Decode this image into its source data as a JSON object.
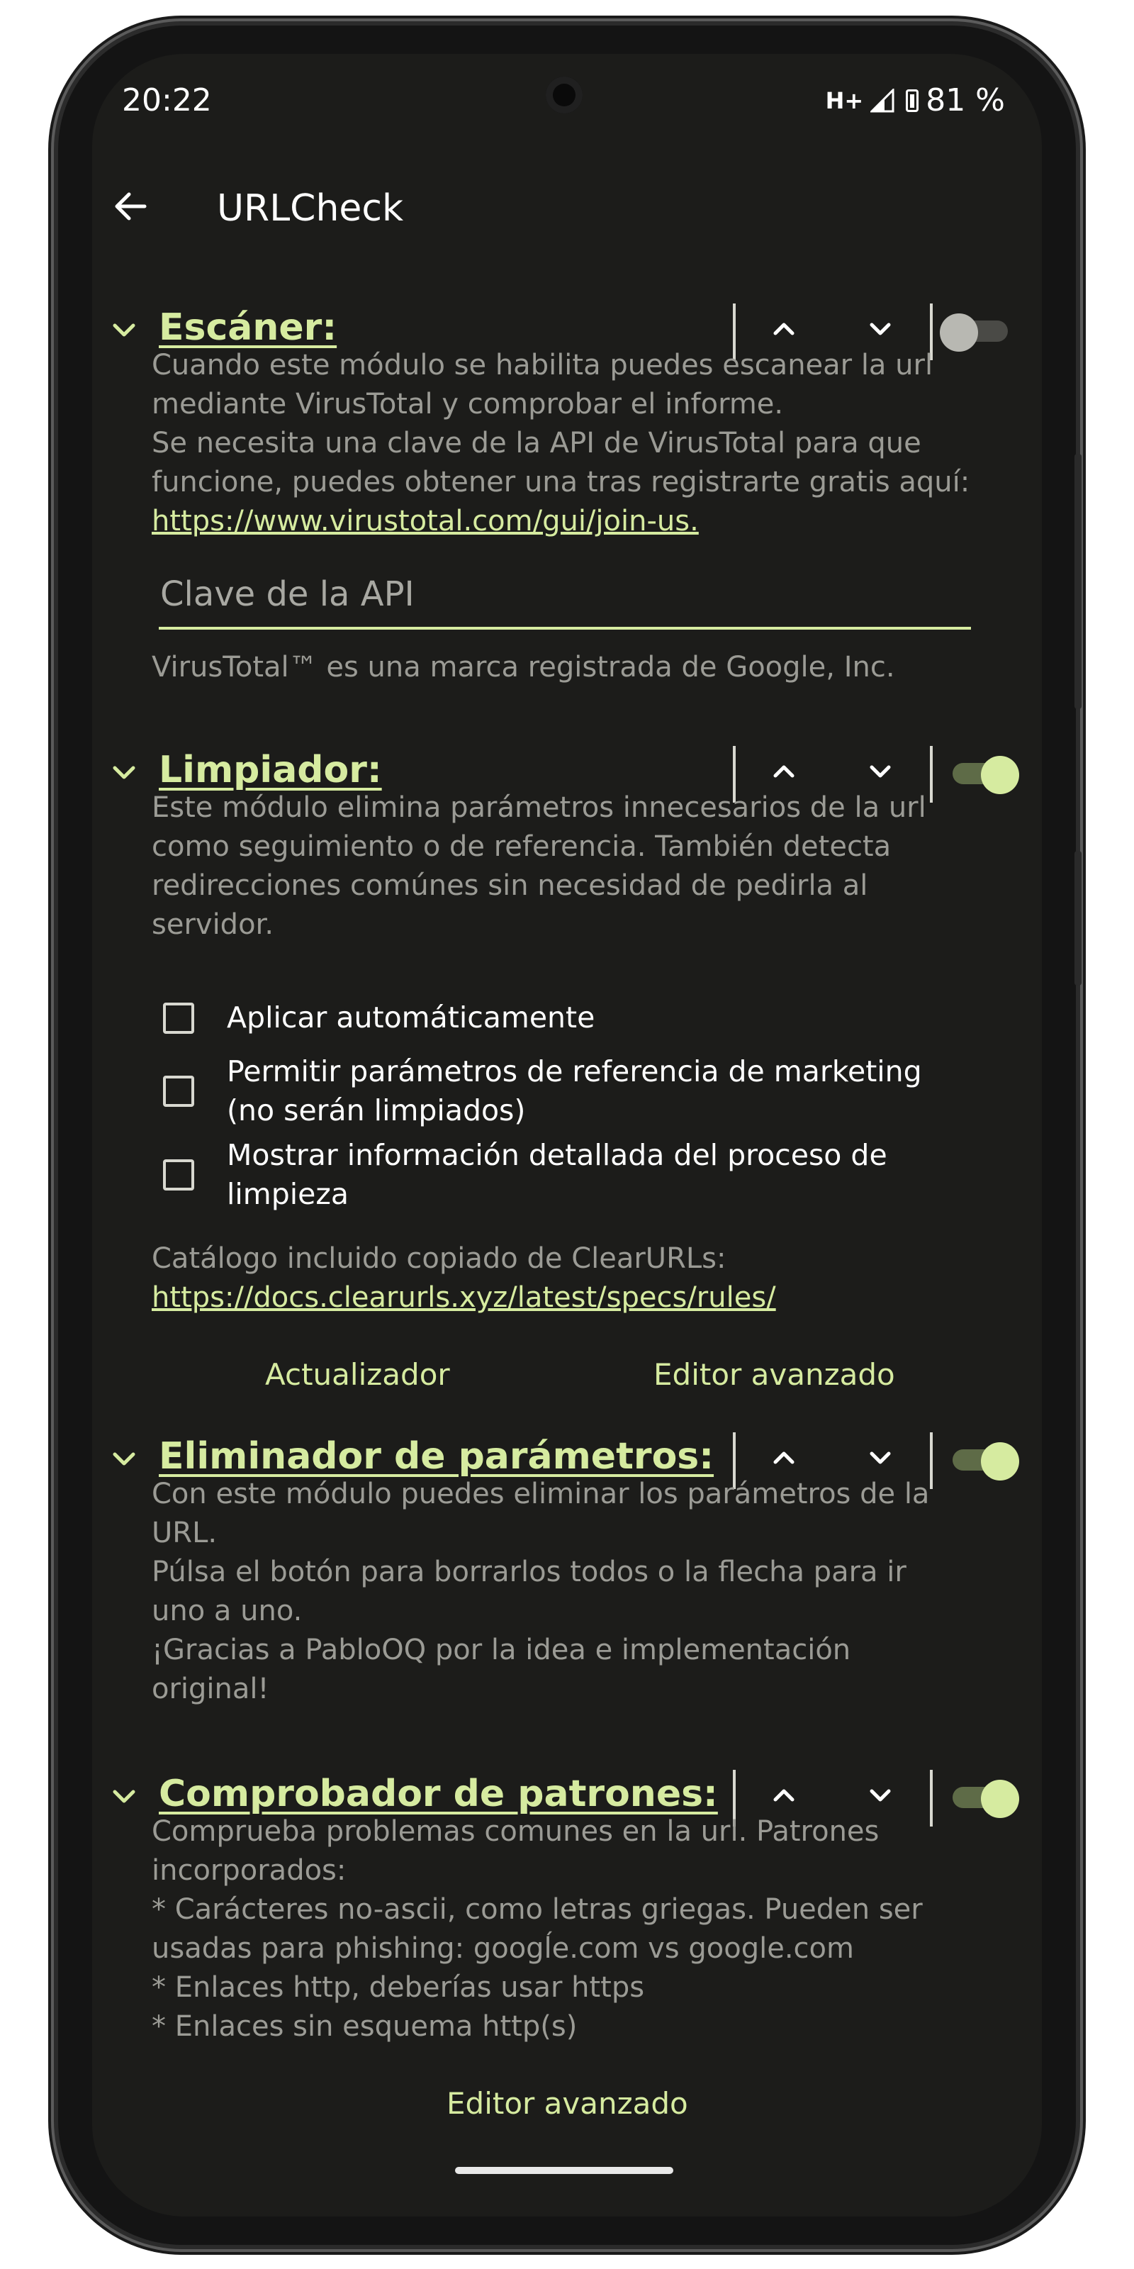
{
  "status_bar": {
    "time": "20:22",
    "network": "H+",
    "battery": "81 %"
  },
  "app_bar": {
    "title": "URLCheck",
    "back_icon": "arrow-left-icon"
  },
  "colors": {
    "accent": "#d6eba0",
    "background": "#1c1c1a",
    "body_text": "#9b9b95"
  },
  "modules": {
    "scanner": {
      "title": "Escáner:",
      "enabled": false,
      "description": [
        "Cuando este módulo se habilita puedes escanear la url",
        "mediante VirusTotal y comprobar el informe.",
        "Se necesita una clave de la API de VirusTotal para que",
        "funcione, puedes obtener una tras registrarte gratis aquí:"
      ],
      "link": "https://www.virustotal.com/gui/join-us.",
      "api_key_placeholder": "Clave de la API",
      "trademark": "VirusTotal™ es una marca registrada de Google, Inc."
    },
    "cleaner": {
      "title": "Limpiador:",
      "enabled": true,
      "description": [
        "Este módulo elimina parámetros innecesarios de la url",
        "como seguimiento o de referencia. También detecta",
        "redirecciones comúnes sin necesidad de pedirla al",
        "servidor."
      ],
      "options": [
        {
          "label": "Aplicar automáticamente",
          "checked": false
        },
        {
          "label": "Permitir parámetros de referencia de marketing (no serán limpiados)",
          "checked": false
        },
        {
          "label": "Mostrar información detallada del proceso de limpieza",
          "checked": false
        }
      ],
      "catalog_text": "Catálogo incluido copiado de ClearURLs:",
      "catalog_link": "https://docs.clearurls.xyz/latest/specs/rules/",
      "updater_button": "Actualizador",
      "advanced_editor_button": "Editor avanzado"
    },
    "param_remover": {
      "title": "Eliminador de parámetros:",
      "enabled": true,
      "description": [
        "Con este módulo puedes eliminar los parámetros de la",
        "URL.",
        "Púlsa el botón para borrarlos todos o la flecha para ir",
        "uno a uno.",
        "¡Gracias a PabloOQ por la idea e implementación",
        "original!"
      ]
    },
    "pattern_checker": {
      "title": "Comprobador de patrones:",
      "enabled": true,
      "description": [
        "Comprueba problemas comunes en la url. Patrones",
        "incorporados:",
        "* Carácteres no-ascii, como letras griegas. Pueden ser",
        "usadas para phishing: googĺe.com vs google.com",
        "* Enlaces http, deberías usar https",
        "* Enlaces sin esquema http(s)"
      ],
      "advanced_editor_button": "Editor avanzado"
    }
  }
}
